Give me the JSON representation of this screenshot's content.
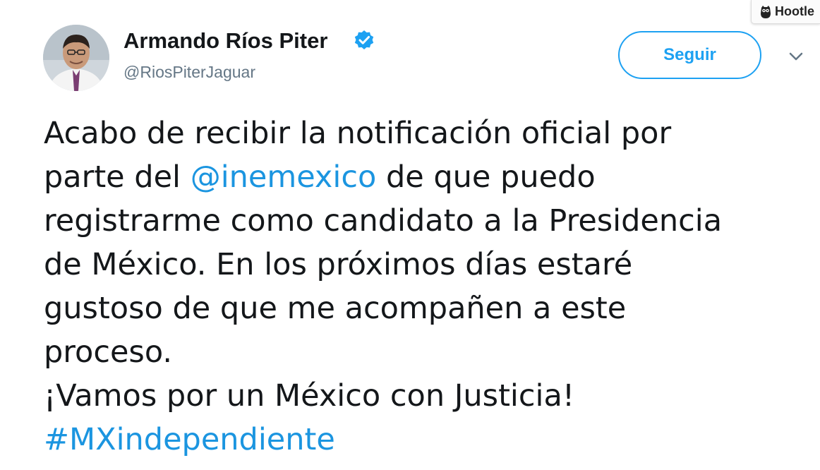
{
  "hootlet": {
    "label": "Hootle"
  },
  "user": {
    "name": "Armando Ríos Piter",
    "handle": "@RiosPiterJaguar",
    "verified": true
  },
  "follow_button": {
    "label": "Seguir"
  },
  "tweet": {
    "line1": "Acabo de recibir la notificación oficial por",
    "line2_pre": "parte del ",
    "mention": "@inemexico",
    "line2_post": " de que puedo",
    "line3": "registrarme como candidato a la Presidencia",
    "line4": "de México. En los próximos días estaré",
    "line5": "gustoso de que me acompañen a este",
    "line6": "proceso.",
    "line7": "¡Vamos por un México con Justicia!",
    "hashtag": "#MXindependiente"
  },
  "colors": {
    "link": "#1b95e0",
    "button": "#1da1f2",
    "text": "#14171a",
    "secondary": "#657786"
  },
  "icons": [
    "hootsuite-owl-icon",
    "verified-badge-icon",
    "chevron-down-icon"
  ]
}
